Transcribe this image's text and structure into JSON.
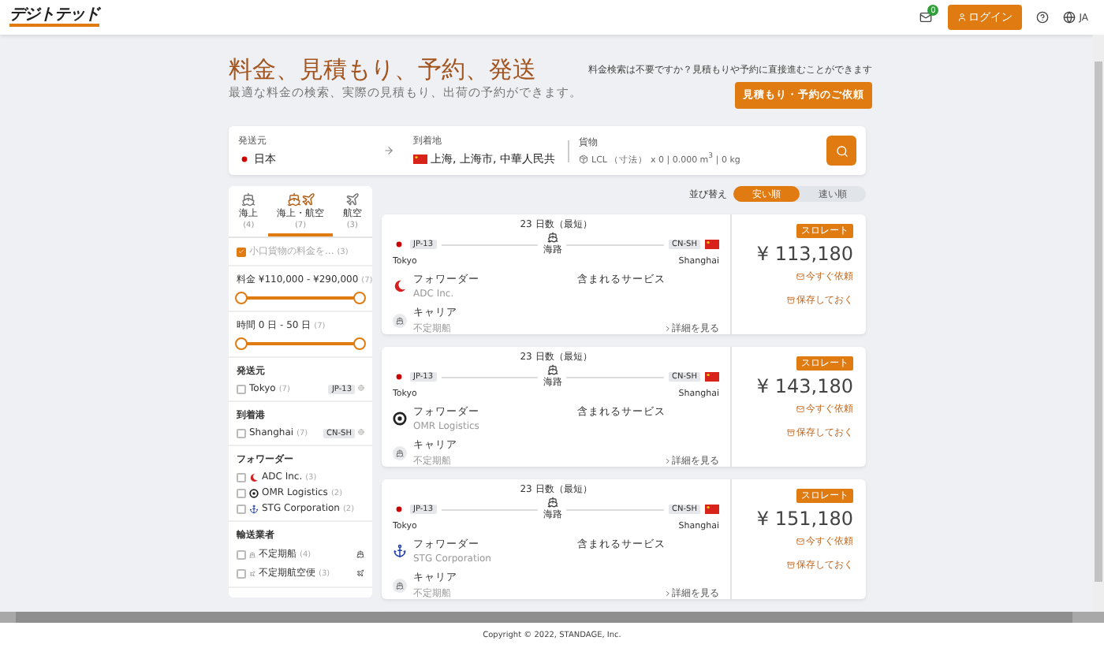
{
  "header": {
    "logo": "デジトテッド",
    "notification_badge": "0",
    "login": "ログイン",
    "language": "JA"
  },
  "hero": {
    "title": "料金、見積もり、予約、発送",
    "subtitle": "最適な料金の検索、実際の見積もり、出荷の予約ができます。",
    "prompt": "料金検索は不要ですか？見積もりや予約に直接進むことができます",
    "request_button": "見積もり・予約のご依頼"
  },
  "search": {
    "fields": [
      {
        "kind": "origin",
        "label": "発送元",
        "value": "日本"
      },
      {
        "kind": "destination",
        "label": "到着地",
        "value": "上海, 上海市, 中華人民共"
      },
      {
        "kind": "cargo",
        "label": "貨物",
        "value": "LCL （寸法） x 0 | 0.000 m$^{3}$ | 0 kg"
      }
    ]
  },
  "sidebar": {
    "tabs": [
      {
        "kind": "sea",
        "label": "海上",
        "count": "(4)",
        "selected": false
      },
      {
        "kind": "both",
        "label": "海上・航空",
        "count": "(7)",
        "selected": true
      },
      {
        "kind": "air",
        "label": "航空",
        "count": "(3)",
        "selected": false
      }
    ],
    "option": {
      "label": "小口貨物の料金を...",
      "count": "(3)",
      "checked": true
    },
    "ranges": [
      {
        "label": "料金 ¥110,000 - ¥290,000",
        "count": "(7)",
        "level": 1
      },
      {
        "label": "時間 0 日 - 50 日",
        "count": "(7)",
        "level": 1
      }
    ],
    "groups": [
      {
        "title": "発送元",
        "items": [
          {
            "kind": "port",
            "label": "Tokyo",
            "count": "(7)",
            "code": "JP-13",
            "checked": false
          }
        ]
      },
      {
        "title": "到着港",
        "items": [
          {
            "kind": "port",
            "label": "Shanghai",
            "count": "(7)",
            "code": "CN-SH",
            "checked": false
          }
        ]
      },
      {
        "title": "フォワーダー",
        "items": [
          {
            "kind": "forwarder",
            "label": "ADC Inc.",
            "count": "(3)",
            "checked": false
          },
          {
            "kind": "forwarder",
            "label": "OMR Logistics",
            "count": "(2)",
            "checked": false
          },
          {
            "kind": "forwarder",
            "label": "STG Corporation",
            "count": "(2)",
            "checked": false
          }
        ]
      },
      {
        "title": "輸送業者",
        "items": [
          {
            "kind": "sea_carrier",
            "label": "不定期船",
            "count": "(4)",
            "checked": false
          },
          {
            "kind": "air_carrier",
            "label": "不定期航空便",
            "count": "(3)",
            "checked": false
          }
        ]
      }
    ]
  },
  "sort": {
    "label": "並び替え",
    "options": [
      {
        "label": "安い順",
        "selected": true
      },
      {
        "label": "速い順",
        "selected": false
      }
    ]
  },
  "results": [
    {
      "transit": "23 日数（最短）",
      "origin_code": "JP-13",
      "origin_city": "Tokyo",
      "mode": "海路",
      "dest_code": "CN-SH",
      "dest_city": "Shanghai",
      "forwarder_label": "フォワーダー",
      "forwarder": "ADC Inc.",
      "services_label": "含まれるサービス",
      "carrier_label": "キャリア",
      "carrier": "不定期船",
      "details_link": "詳細を見る",
      "badge": "スロレート",
      "price": "¥ 113,180",
      "request": "今すぐ依頼",
      "save": "保存しておく"
    },
    {
      "transit": "23 日数（最短）",
      "origin_code": "JP-13",
      "origin_city": "Tokyo",
      "mode": "海路",
      "dest_code": "CN-SH",
      "dest_city": "Shanghai",
      "forwarder_label": "フォワーダー",
      "forwarder": "OMR Logistics",
      "services_label": "含まれるサービス",
      "carrier_label": "キャリア",
      "carrier": "不定期船",
      "details_link": "詳細を見る",
      "badge": "スロレート",
      "price": "¥ 143,180",
      "request": "今すぐ依頼",
      "save": "保存しておく"
    },
    {
      "transit": "23 日数（最短）",
      "origin_code": "JP-13",
      "origin_city": "Tokyo",
      "mode": "海路",
      "dest_code": "CN-SH",
      "dest_city": "Shanghai",
      "forwarder_label": "フォワーダー",
      "forwarder": "STG Corporation",
      "services_label": "含まれるサービス",
      "carrier_label": "キャリア",
      "carrier": "不定期船",
      "details_link": "詳細を見る",
      "badge": "スロレート",
      "price": "¥ 151,180",
      "request": "今すぐ依頼",
      "save": "保存しておく"
    }
  ],
  "footer": "Copyright © 2022, STANDAGE, Inc."
}
